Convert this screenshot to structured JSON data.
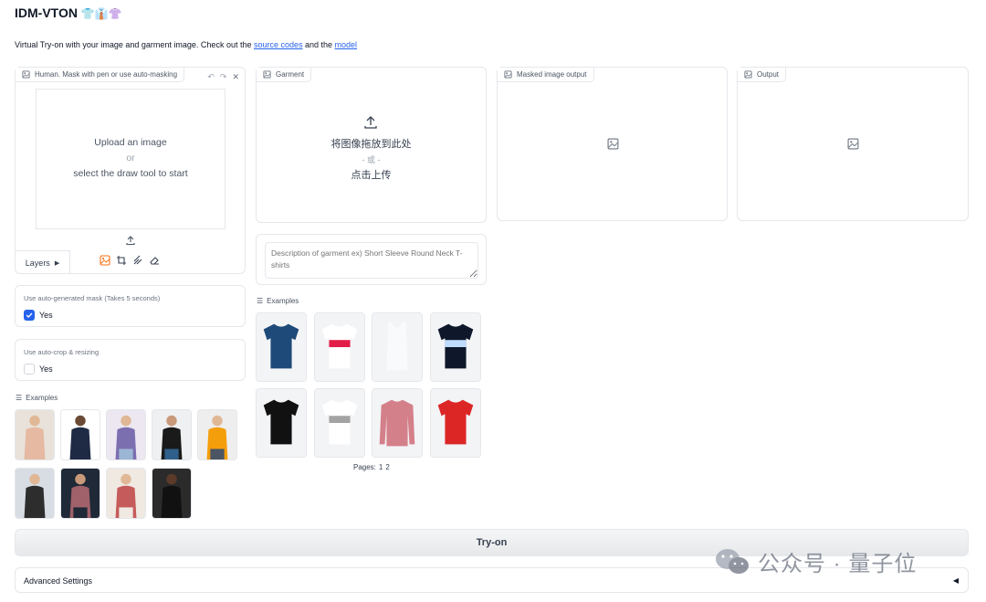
{
  "app": {
    "title": "IDM-VTON",
    "title_emoji": "👕👔👚",
    "subtitle_prefix": "Virtual Try-on with your image and garment image. Check out the ",
    "link_source": "source codes",
    "subtitle_and": " and the ",
    "link_model": "model"
  },
  "human": {
    "label": "Human. Mask with pen or use auto-masking",
    "upload_line1": "Upload an image",
    "upload_or": "or",
    "upload_line2": "select the draw tool to start",
    "layers_label": "Layers"
  },
  "garment": {
    "label": "Garment",
    "drop_line1": "将图像拖放到此处",
    "drop_or": "- 或 -",
    "drop_line2": "点击上传",
    "desc_placeholder": "Description of garment ex) Short Sleeve Round Neck T-shirts"
  },
  "masked": {
    "label": "Masked image output"
  },
  "output": {
    "label": "Output"
  },
  "auto_mask": {
    "label": "Use auto-generated mask (Takes 5 seconds)",
    "option": "Yes",
    "checked": true
  },
  "auto_crop": {
    "label": "Use auto-crop & resizing",
    "option": "Yes",
    "checked": false
  },
  "human_examples": {
    "label": "Examples"
  },
  "garment_examples": {
    "label": "Examples",
    "pages_label": "Pages:",
    "page1": "1",
    "page2": "2"
  },
  "tryon": {
    "label": "Try-on"
  },
  "advanced": {
    "label": "Advanced Settings",
    "arrow": "◀"
  },
  "watermark": {
    "text": "公众号 · 量子位"
  },
  "colors": {
    "accent": "#f97316",
    "checkbox": "#2563eb",
    "link": "#2563eb"
  }
}
